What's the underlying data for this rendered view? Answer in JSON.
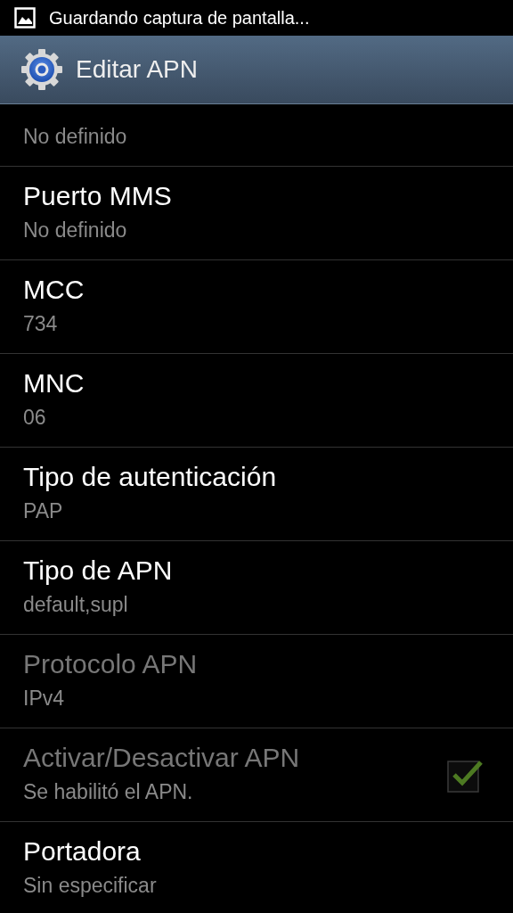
{
  "status_bar": {
    "notification": "Guardando captura de pantalla..."
  },
  "title_bar": {
    "title": "Editar APN"
  },
  "settings": [
    {
      "kind": "text",
      "summary": "No definido"
    },
    {
      "kind": "text",
      "title": "Puerto MMS",
      "summary": "No definido",
      "disabled": false
    },
    {
      "kind": "text",
      "title": "MCC",
      "summary": "734",
      "disabled": false
    },
    {
      "kind": "text",
      "title": "MNC",
      "summary": "06",
      "disabled": false
    },
    {
      "kind": "text",
      "title": "Tipo de autenticación",
      "summary": "PAP",
      "disabled": false
    },
    {
      "kind": "text",
      "title": "Tipo de APN",
      "summary": "default,supl",
      "disabled": false
    },
    {
      "kind": "text",
      "title": "Protocolo APN",
      "summary": "IPv4",
      "disabled": true
    },
    {
      "kind": "checkbox",
      "title": "Activar/Desactivar APN",
      "summary": "Se habilitó el APN.",
      "disabled": true,
      "checked": true
    },
    {
      "kind": "text",
      "title": "Portadora",
      "summary": "Sin especificar",
      "disabled": false
    }
  ]
}
